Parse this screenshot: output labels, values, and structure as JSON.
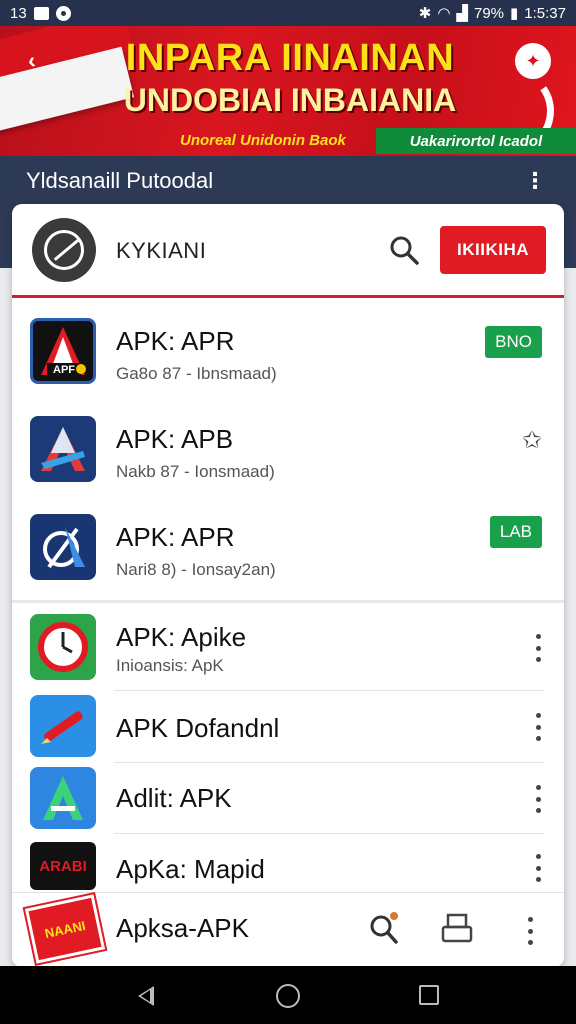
{
  "status_bar": {
    "time_left": "13",
    "battery": "79%",
    "clock": "1:5:37"
  },
  "banner": {
    "title_line1": "INPARA IINAINAN",
    "title_line2": "UNDOBIAI INBAIANIA",
    "subtitle": "Unoreal Unidonin Baok",
    "tag": "Uakarirortol Icadol",
    "back_label": "‹"
  },
  "app_bar": {
    "title": "Yldsanaill Putoodal",
    "menu_icon": "more-vert-icon"
  },
  "header": {
    "brand": "KYKIANI",
    "search_icon": "search-icon",
    "button_label": "IKIIKIHA"
  },
  "apps": [
    {
      "title": "APK: APR",
      "subtitle": "Ga8o 87 - Ibnsmaad)",
      "badge": "BNO",
      "icon": "apk-a-icon"
    },
    {
      "title": "APK: APB",
      "subtitle": "Nakb 87 - Ionsmaad)",
      "badge": "",
      "icon": "apk-a-blue-icon",
      "action_icon": "bookmark-star-icon"
    },
    {
      "title": "APK: APR",
      "subtitle": "Nari8 8) - Ionsay2an)",
      "badge": "LAB",
      "icon": "apk-circle-icon"
    },
    {
      "title": "APK: Apike",
      "subtitle": "Inioansis: ApK",
      "icon": "clock-icon"
    },
    {
      "title": "APK Dofandnl",
      "subtitle": "",
      "icon": "pen-icon"
    },
    {
      "title": "Adlit: APK",
      "subtitle": "",
      "icon": "adlit-icon"
    },
    {
      "title": "ApKa: Mapid",
      "subtitle": "",
      "icon": "arabi-icon",
      "icon_text": "ARABI"
    }
  ],
  "bottom": {
    "label": "Apksa-APK",
    "icon_text": "NAANI",
    "search_icon": "search-icon",
    "print_icon": "printer-icon"
  },
  "colors": {
    "accent_red": "#e01b24",
    "navy": "#2d3a56",
    "green": "#19a04a"
  }
}
